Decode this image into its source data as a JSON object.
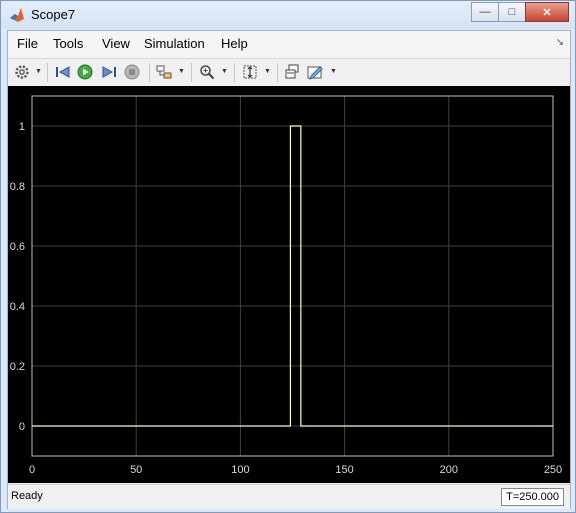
{
  "window": {
    "title": "Scope7",
    "minimize_label": "—",
    "restore_label": "□",
    "close_label": "✕"
  },
  "menu": {
    "file": "File",
    "tools": "Tools",
    "view": "View",
    "simulation": "Simulation",
    "help": "Help"
  },
  "toolbar": {
    "icons": [
      "gear-icon",
      "step-back-icon",
      "run-icon",
      "step-forward-icon",
      "stop-icon",
      "highlight-block-icon",
      "zoom-icon",
      "scale-axes-icon",
      "restore-layout-icon",
      "edit-style-icon"
    ]
  },
  "status": {
    "text": "Ready",
    "time": "T=250.000"
  },
  "colors": {
    "plot_background": "#000000",
    "grid": "#404040",
    "signal": "#ffff99",
    "tick_label": "#d8d8d8"
  },
  "chart_data": {
    "type": "line",
    "x_ticks": [
      "0",
      "50",
      "100",
      "150",
      "200",
      "250"
    ],
    "y_ticks": [
      "0",
      "0.2",
      "0.4",
      "0.6",
      "0.8",
      "1"
    ],
    "xlim": [
      0,
      250
    ],
    "ylim": [
      -0.1,
      1.1
    ],
    "grid": true,
    "series": [
      {
        "x": [
          0,
          124,
          124,
          129,
          129,
          250
        ],
        "y": [
          0,
          0,
          1,
          1,
          0,
          0
        ]
      }
    ]
  }
}
